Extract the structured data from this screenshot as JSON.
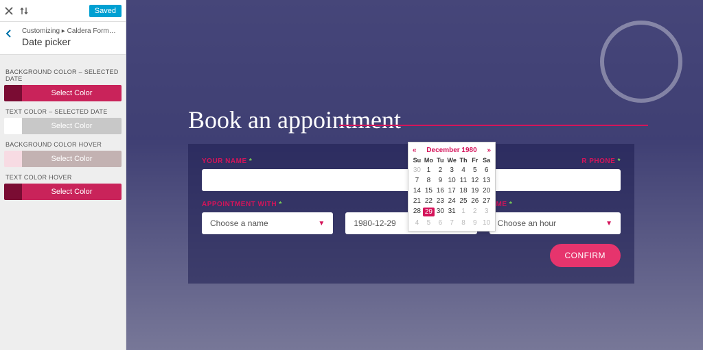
{
  "topbar": {
    "saved": "Saved"
  },
  "crumb": {
    "path": "Customizing ▸ Caldera Forms Style C...",
    "title": "Date picker"
  },
  "sections": [
    {
      "label": "BACKGROUND COLOR – SELECTED DATE",
      "swatch": "#7a0c33",
      "btn_bg": "#c9235a",
      "btn_text": "Select Color",
      "btn_color": "#ffffff"
    },
    {
      "label": "TEXT COLOR – SELECTED DATE",
      "swatch": "#ffffff",
      "btn_bg": "#c8c8c8",
      "btn_text": "Select Color",
      "btn_color": "#ffffff"
    },
    {
      "label": "BACKGROUND COLOR HOVER",
      "swatch": "#f7dbe3",
      "btn_bg": "#c3b2b2",
      "btn_text": "Select Color",
      "btn_color": "#ffffff"
    },
    {
      "label": "TEXT COLOR HOVER",
      "swatch": "#7a0c33",
      "btn_bg": "#c9235a",
      "btn_text": "Select Color",
      "btn_color": "#ffffff"
    }
  ],
  "headline": "Book an appointment",
  "form": {
    "name_label": "YOUR NAME",
    "phone_label": "R PHONE",
    "appt_label": "APPOINTMENT WITH",
    "time_label": "TIME",
    "name_value": "",
    "phone_value": "",
    "appt_placeholder": "Choose a name",
    "date_value": "1980-12-29",
    "time_placeholder": "Choose an hour",
    "confirm": "CONFIRM",
    "star": "*"
  },
  "dp": {
    "title": "December 1980",
    "dow": [
      "Su",
      "Mo",
      "Tu",
      "We",
      "Th",
      "Fr",
      "Sa"
    ],
    "rows": [
      [
        {
          "n": 30,
          "m": 1
        },
        {
          "n": 1
        },
        {
          "n": 2
        },
        {
          "n": 3
        },
        {
          "n": 4
        },
        {
          "n": 5
        },
        {
          "n": 6
        }
      ],
      [
        {
          "n": 7
        },
        {
          "n": 8
        },
        {
          "n": 9
        },
        {
          "n": 10
        },
        {
          "n": 11
        },
        {
          "n": 12
        },
        {
          "n": 13
        }
      ],
      [
        {
          "n": 14
        },
        {
          "n": 15
        },
        {
          "n": 16
        },
        {
          "n": 17
        },
        {
          "n": 18
        },
        {
          "n": 19
        },
        {
          "n": 20
        }
      ],
      [
        {
          "n": 21
        },
        {
          "n": 22
        },
        {
          "n": 23
        },
        {
          "n": 24
        },
        {
          "n": 25
        },
        {
          "n": 26
        },
        {
          "n": 27
        }
      ],
      [
        {
          "n": 28
        },
        {
          "n": 29,
          "sel": 1
        },
        {
          "n": 30
        },
        {
          "n": 31
        },
        {
          "n": 1,
          "m": 1
        },
        {
          "n": 2,
          "m": 1
        },
        {
          "n": 3,
          "m": 1
        }
      ],
      [
        {
          "n": 4,
          "m": 1
        },
        {
          "n": 5,
          "m": 1
        },
        {
          "n": 6,
          "m": 1
        },
        {
          "n": 7,
          "m": 1
        },
        {
          "n": 8,
          "m": 1
        },
        {
          "n": 9,
          "m": 1
        },
        {
          "n": 10,
          "m": 1
        }
      ]
    ]
  }
}
